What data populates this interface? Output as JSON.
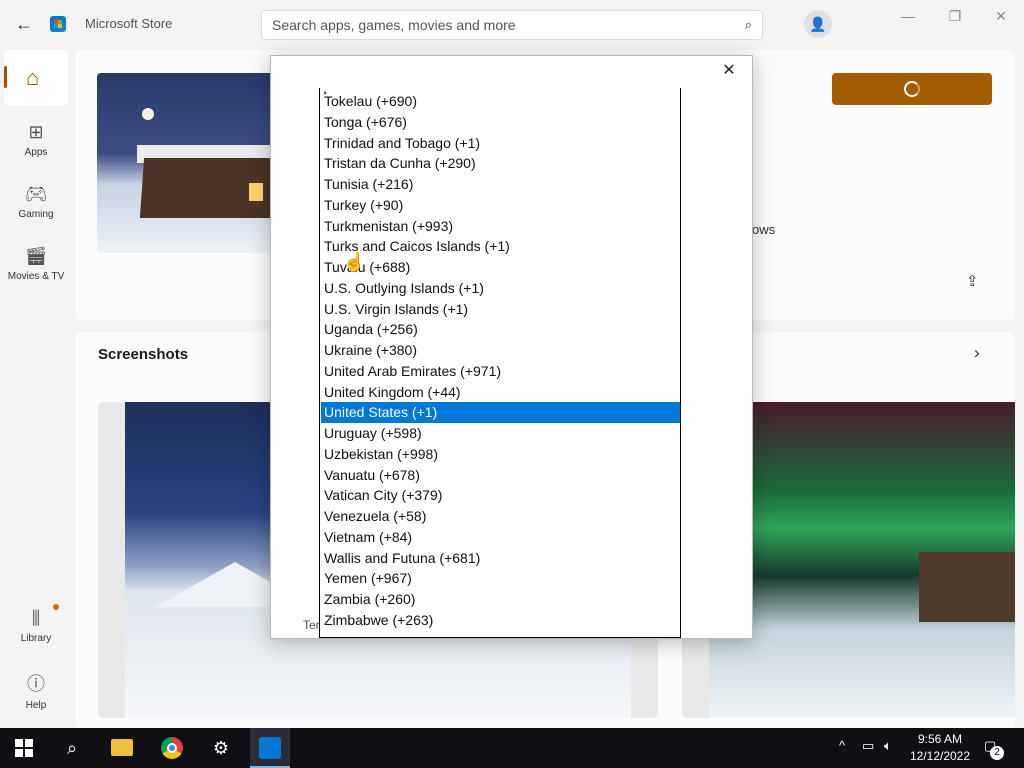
{
  "window": {
    "app_title": "Microsoft Store",
    "back_icon": "←",
    "minimize_icon": "—",
    "restore_icon": "❐",
    "close_icon": "✕"
  },
  "search": {
    "placeholder": "Search apps, games, movies and more"
  },
  "nav": {
    "items": [
      {
        "label": "Home",
        "icon": "home-icon"
      },
      {
        "label": "Apps",
        "icon": "apps-icon"
      },
      {
        "label": "Gaming",
        "icon": "gaming-icon"
      },
      {
        "label": "Movies & TV",
        "icon": "movies-icon"
      },
      {
        "label": "Library",
        "icon": "library-icon"
      },
      {
        "label": "Help",
        "icon": "help-icon"
      }
    ]
  },
  "product": {
    "partial_text": "ows"
  },
  "screenshots": {
    "title": "Screenshots"
  },
  "modal": {
    "close_label": "✕",
    "footer_partial": "Ter"
  },
  "country_list": {
    "partial_above": "...",
    "selected": "United States (+1)",
    "options": [
      "Tokelau (+690)",
      "Tonga (+676)",
      "Trinidad and Tobago (+1)",
      "Tristan da Cunha (+290)",
      "Tunisia (+216)",
      "Turkey (+90)",
      "Turkmenistan (+993)",
      "Turks and Caicos Islands (+1)",
      "Tuvalu (+688)",
      "U.S. Outlying Islands (+1)",
      "U.S. Virgin Islands (+1)",
      "Uganda (+256)",
      "Ukraine (+380)",
      "United Arab Emirates (+971)",
      "United Kingdom (+44)",
      "United States (+1)",
      "Uruguay (+598)",
      "Uzbekistan (+998)",
      "Vanuatu (+678)",
      "Vatican City (+379)",
      "Venezuela (+58)",
      "Vietnam (+84)",
      "Wallis and Futuna (+681)",
      "Yemen (+967)",
      "Zambia (+260)",
      "Zimbabwe (+263)"
    ]
  },
  "taskbar": {
    "time": "9:56 AM",
    "date": "12/12/2022",
    "notification_count": "2"
  },
  "colors": {
    "accent": "#a35c00",
    "selection": "#0078d7",
    "taskbar": "#0f0f14"
  }
}
